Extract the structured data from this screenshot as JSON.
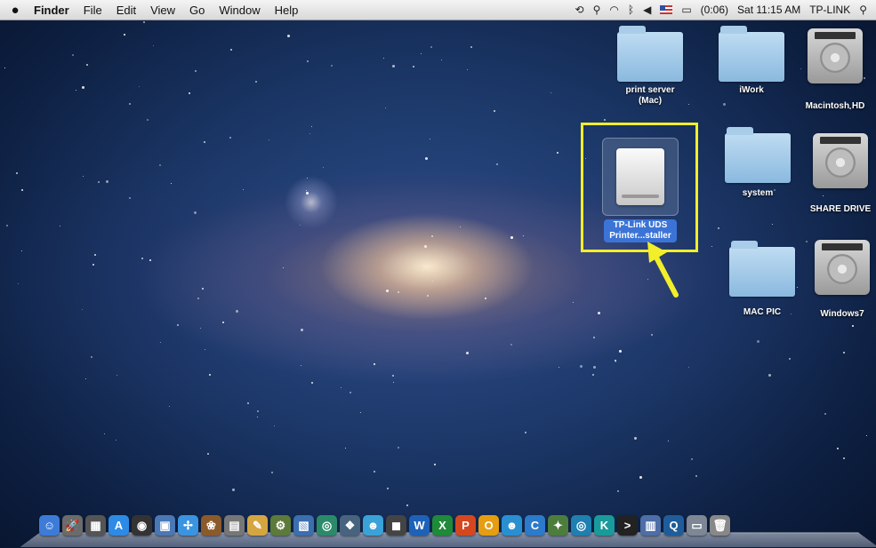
{
  "menubar": {
    "app_name": "Finder",
    "menus": [
      "File",
      "Edit",
      "View",
      "Go",
      "Window",
      "Help"
    ],
    "battery": "(0:06)",
    "clock": "Sat 11:15 AM",
    "user": "TP-LINK",
    "status_icons": [
      "timemachine-icon",
      "sync-icon",
      "wifi-icon",
      "bluetooth-icon",
      "volume-icon",
      "flag-icon",
      "battery-icon",
      "spotlight-icon"
    ]
  },
  "desktop": {
    "icons": [
      {
        "name": "print server (Mac)",
        "line1": "print server",
        "line2": "(Mac)",
        "type": "folder"
      },
      {
        "name": "iWork",
        "line1": "iWork",
        "line2": "",
        "type": "folder"
      },
      {
        "name": "Macintosh HD",
        "line1": "Macintosh HD",
        "line2": "",
        "type": "hard-drive"
      },
      {
        "name": "system",
        "line1": "system",
        "line2": "",
        "type": "folder"
      },
      {
        "name": "SHARE DRIVE",
        "line1": "SHARE DRIVE",
        "line2": "",
        "type": "hard-drive"
      },
      {
        "name": "MAC PIC",
        "line1": "MAC PIC",
        "line2": "",
        "type": "folder"
      },
      {
        "name": "Windows7",
        "line1": "Windows7",
        "line2": "",
        "type": "hard-drive"
      }
    ],
    "selected_icon": {
      "line1": "TP-Link UDS",
      "line2": "Printer...staller",
      "type": "disk-image"
    }
  },
  "highlight_color": "#f2ee2a",
  "selection_color": "#3b74d6",
  "dock": {
    "items": [
      {
        "icon": "finder-icon",
        "color": "#3d7bd8",
        "glyph": "☺"
      },
      {
        "icon": "launchpad-icon",
        "color": "#6b6b6b",
        "glyph": "🚀"
      },
      {
        "icon": "mission-control-icon",
        "color": "#555",
        "glyph": "▦"
      },
      {
        "icon": "app-store-icon",
        "color": "#2d8be6",
        "glyph": "A"
      },
      {
        "icon": "dashboard-icon",
        "color": "#333",
        "glyph": "◉"
      },
      {
        "icon": "preview-icon",
        "color": "#4a78b5",
        "glyph": "▣"
      },
      {
        "icon": "safari-icon",
        "color": "#3a94e0",
        "glyph": "✢"
      },
      {
        "icon": "iphoto-icon",
        "color": "#8b5a2b",
        "glyph": "❀"
      },
      {
        "icon": "image-capture-icon",
        "color": "#777",
        "glyph": "▤"
      },
      {
        "icon": "textedit-icon",
        "color": "#d5a640",
        "glyph": "✎"
      },
      {
        "icon": "automator-icon",
        "color": "#5c7a3a",
        "glyph": "⚙"
      },
      {
        "icon": "iphoto-2-icon",
        "color": "#3b6fb0",
        "glyph": "▧"
      },
      {
        "icon": "network-icon",
        "color": "#2b8a6a",
        "glyph": "◎"
      },
      {
        "icon": "photo-icon",
        "color": "#48637e",
        "glyph": "❖"
      },
      {
        "icon": "messenger-icon",
        "color": "#3aa2d8",
        "glyph": "☻"
      },
      {
        "icon": "facetime-icon",
        "color": "#444",
        "glyph": "◼"
      },
      {
        "icon": "word-icon",
        "color": "#1d62b8",
        "glyph": "W"
      },
      {
        "icon": "excel-icon",
        "color": "#1f8a3a",
        "glyph": "X"
      },
      {
        "icon": "powerpoint-icon",
        "color": "#d5481f",
        "glyph": "P"
      },
      {
        "icon": "outlook-icon",
        "color": "#e59e12",
        "glyph": "O"
      },
      {
        "icon": "messenger-2-icon",
        "color": "#2a8fd1",
        "glyph": "☻"
      },
      {
        "icon": "communicator-icon",
        "color": "#2c7ac9",
        "glyph": "C"
      },
      {
        "icon": "vnc-icon",
        "color": "#4d7d3c",
        "glyph": "✦"
      },
      {
        "icon": "network-2-icon",
        "color": "#1f7fb0",
        "glyph": "◎"
      },
      {
        "icon": "kindle-icon",
        "color": "#1a9b9b",
        "glyph": "K"
      },
      {
        "icon": "terminal-icon",
        "color": "#222",
        "glyph": ">"
      },
      {
        "icon": "utility-icon",
        "color": "#4d6ea7",
        "glyph": "▥"
      },
      {
        "icon": "quicktime-icon",
        "color": "#1f5d9a",
        "glyph": "Q"
      },
      {
        "icon": "downloads-icon",
        "color": "#7d8795",
        "glyph": "▭"
      },
      {
        "icon": "trash-icon",
        "color": "#888",
        "glyph": "🗑"
      }
    ]
  }
}
